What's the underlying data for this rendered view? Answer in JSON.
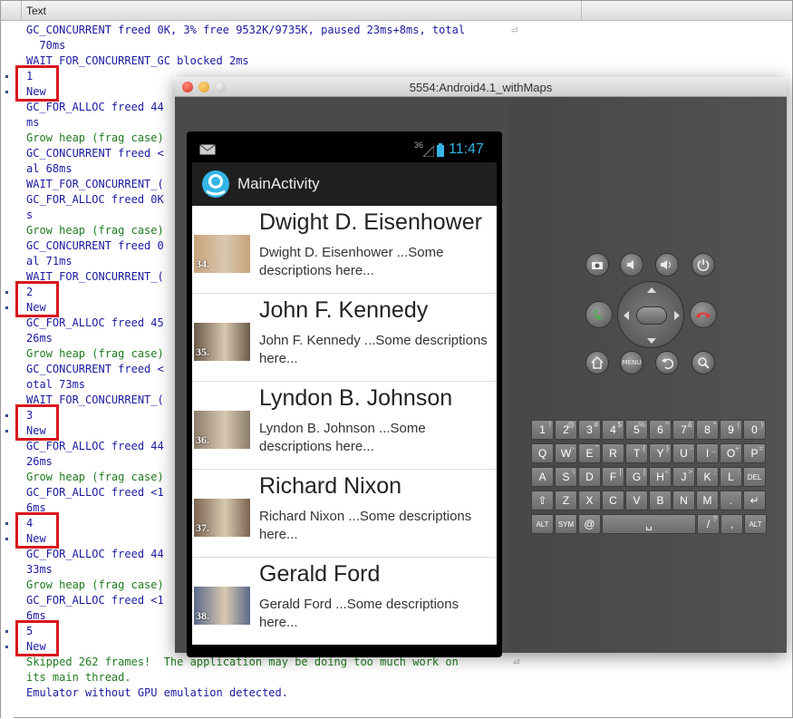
{
  "log": {
    "header": "Text",
    "lines": [
      {
        "text": "GC_CONCURRENT freed 0K, 3% free 9532K/9735K, paused 23ms+8ms, total",
        "c": "b"
      },
      {
        "text": "  70ms",
        "c": "b"
      },
      {
        "text": "WAIT_FOR_CONCURRENT_GC blocked 2ms",
        "c": "b"
      },
      {
        "text": "1",
        "c": "b"
      },
      {
        "text": "New",
        "c": "b"
      },
      {
        "text": "GC_FOR_ALLOC freed 44",
        "c": "b"
      },
      {
        "text": "ms",
        "c": "b"
      },
      {
        "text": "Grow heap (frag case)",
        "c": "g"
      },
      {
        "text": "GC_CONCURRENT freed <",
        "c": "b"
      },
      {
        "text": "al 68ms",
        "c": "b"
      },
      {
        "text": "WAIT_FOR_CONCURRENT_(",
        "c": "b"
      },
      {
        "text": "GC_FOR_ALLOC freed 0K",
        "c": "b"
      },
      {
        "text": "s",
        "c": "b"
      },
      {
        "text": "Grow heap (frag case)",
        "c": "g"
      },
      {
        "text": "GC_CONCURRENT freed 0",
        "c": "b"
      },
      {
        "text": "al 71ms",
        "c": "b"
      },
      {
        "text": "WAIT_FOR_CONCURRENT_(",
        "c": "b"
      },
      {
        "text": "2",
        "c": "b"
      },
      {
        "text": "New",
        "c": "b"
      },
      {
        "text": "GC_FOR_ALLOC freed 45",
        "c": "b"
      },
      {
        "text": "26ms",
        "c": "b"
      },
      {
        "text": "Grow heap (frag case)",
        "c": "g"
      },
      {
        "text": "GC_CONCURRENT freed <",
        "c": "b"
      },
      {
        "text": "otal 73ms",
        "c": "b"
      },
      {
        "text": "WAIT_FOR_CONCURRENT_(",
        "c": "b"
      },
      {
        "text": "3",
        "c": "b"
      },
      {
        "text": "New",
        "c": "b"
      },
      {
        "text": "GC_FOR_ALLOC freed 44",
        "c": "b"
      },
      {
        "text": "26ms",
        "c": "b"
      },
      {
        "text": "Grow heap (frag case)",
        "c": "g"
      },
      {
        "text": "GC_FOR_ALLOC freed <1",
        "c": "b"
      },
      {
        "text": "6ms",
        "c": "b"
      },
      {
        "text": "4",
        "c": "b"
      },
      {
        "text": "New",
        "c": "b"
      },
      {
        "text": "GC_FOR_ALLOC freed 44",
        "c": "b"
      },
      {
        "text": "33ms",
        "c": "b"
      },
      {
        "text": "Grow heap (frag case)",
        "c": "g"
      },
      {
        "text": "GC_FOR_ALLOC freed <1",
        "c": "b"
      },
      {
        "text": "6ms",
        "c": "b"
      },
      {
        "text": "5",
        "c": "b"
      },
      {
        "text": "New",
        "c": "b"
      },
      {
        "text": "Skipped 262 frames!  The application may be doing too much work on",
        "c": "g"
      },
      {
        "text": "its main thread.",
        "c": "g"
      },
      {
        "text": "Emulator without GPU emulation detected.",
        "c": "b"
      }
    ]
  },
  "emulator": {
    "title": "5554:Android4.1_withMaps",
    "status_signal": "36",
    "status_time": "11:47",
    "app_title": "MainActivity",
    "items": [
      {
        "name": "Dwight D. Eisenhower",
        "desc": "Dwight D. Eisenhower ...Some descriptions here...",
        "badge": "34."
      },
      {
        "name": "John F. Kennedy",
        "desc": "John F. Kennedy ...Some descriptions here...",
        "badge": "35."
      },
      {
        "name": "Lyndon B. Johnson",
        "desc": "Lyndon B. Johnson ...Some descriptions here...",
        "badge": "36."
      },
      {
        "name": "Richard Nixon",
        "desc": "Richard Nixon ...Some descriptions here...",
        "badge": "37."
      },
      {
        "name": "Gerald Ford",
        "desc": "Gerald Ford ...Some descriptions here...",
        "badge": "38."
      }
    ],
    "menu_label": "MENU",
    "keyboard": {
      "row1": [
        [
          "1",
          "!"
        ],
        [
          "2",
          "@"
        ],
        [
          "3",
          "#"
        ],
        [
          "4",
          "$"
        ],
        [
          "5",
          "%"
        ],
        [
          "6",
          "^"
        ],
        [
          "7",
          "&"
        ],
        [
          "8",
          "*"
        ],
        [
          "9",
          "("
        ],
        [
          "0",
          ")"
        ]
      ],
      "row2": [
        [
          "Q",
          ""
        ],
        [
          "W",
          "~"
        ],
        [
          "E",
          "\""
        ],
        [
          "R",
          ""
        ],
        [
          "T",
          "{"
        ],
        [
          "Y",
          "}"
        ],
        [
          "U",
          "-"
        ],
        [
          "I",
          "_"
        ],
        [
          "O",
          "+"
        ],
        [
          "P",
          "="
        ]
      ],
      "row3": [
        [
          "A",
          ""
        ],
        [
          "S",
          "\\"
        ],
        [
          "D",
          ""
        ],
        [
          "F",
          "["
        ],
        [
          "G",
          "]"
        ],
        [
          "H",
          "<"
        ],
        [
          "J",
          ">"
        ],
        [
          "K",
          ";"
        ],
        [
          "L",
          ":"
        ],
        [
          "DEL",
          ""
        ]
      ],
      "row4": [
        [
          "⇧",
          ""
        ],
        [
          "Z",
          ""
        ],
        [
          "X",
          ""
        ],
        [
          "C",
          ""
        ],
        [
          "V",
          ""
        ],
        [
          "B",
          ""
        ],
        [
          "N",
          ""
        ],
        [
          "M",
          ""
        ],
        [
          ".",
          ""
        ],
        [
          "↵",
          ""
        ]
      ],
      "row5": [
        [
          "ALT",
          ""
        ],
        [
          "SYM",
          ""
        ],
        [
          "@",
          ""
        ],
        [
          "␣",
          ""
        ],
        [
          "/",
          "?"
        ],
        [
          ",",
          ""
        ],
        [
          "ALT",
          ""
        ]
      ]
    }
  },
  "colors": {
    "highlight": "#d9161c",
    "log_blue": "#1a1aa0",
    "log_green": "#1f7a1f"
  }
}
